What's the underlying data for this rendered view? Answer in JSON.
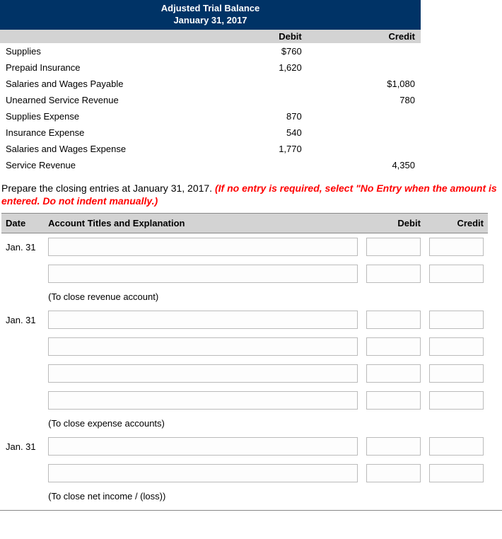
{
  "trial_balance": {
    "title_line1": "Adjusted Trial Balance",
    "title_line2": "January 31, 2017",
    "col_debit": "Debit",
    "col_credit": "Credit",
    "rows": [
      {
        "account": "Supplies",
        "debit": "$760",
        "credit": ""
      },
      {
        "account": "Prepaid Insurance",
        "debit": "1,620",
        "credit": ""
      },
      {
        "account": "Salaries and Wages Payable",
        "debit": "",
        "credit": "$1,080"
      },
      {
        "account": "Unearned Service Revenue",
        "debit": "",
        "credit": "780"
      },
      {
        "account": "Supplies Expense",
        "debit": "870",
        "credit": ""
      },
      {
        "account": "Insurance Expense",
        "debit": "540",
        "credit": ""
      },
      {
        "account": "Salaries and Wages Expense",
        "debit": "1,770",
        "credit": ""
      },
      {
        "account": "Service Revenue",
        "debit": "",
        "credit": "4,350"
      }
    ]
  },
  "instructions": {
    "plain": "Prepare the closing entries at January 31, 2017. ",
    "red": "(If no entry is required, select \"No Entry when the amount is entered. Do not indent manually.)"
  },
  "entries": {
    "head_date": "Date",
    "head_acct": "Account Titles and Explanation",
    "head_debit": "Debit",
    "head_credit": "Credit",
    "rows": [
      {
        "date": "Jan. 31",
        "type": "input"
      },
      {
        "date": "",
        "type": "input"
      },
      {
        "date": "",
        "type": "explain",
        "text": "(To close revenue account)"
      },
      {
        "date": "Jan. 31",
        "type": "input"
      },
      {
        "date": "",
        "type": "input"
      },
      {
        "date": "",
        "type": "input"
      },
      {
        "date": "",
        "type": "input"
      },
      {
        "date": "",
        "type": "explain",
        "text": "(To close expense accounts)"
      },
      {
        "date": "Jan. 31",
        "type": "input"
      },
      {
        "date": "",
        "type": "input"
      },
      {
        "date": "",
        "type": "explain",
        "text": "(To close net income / (loss))"
      }
    ]
  }
}
